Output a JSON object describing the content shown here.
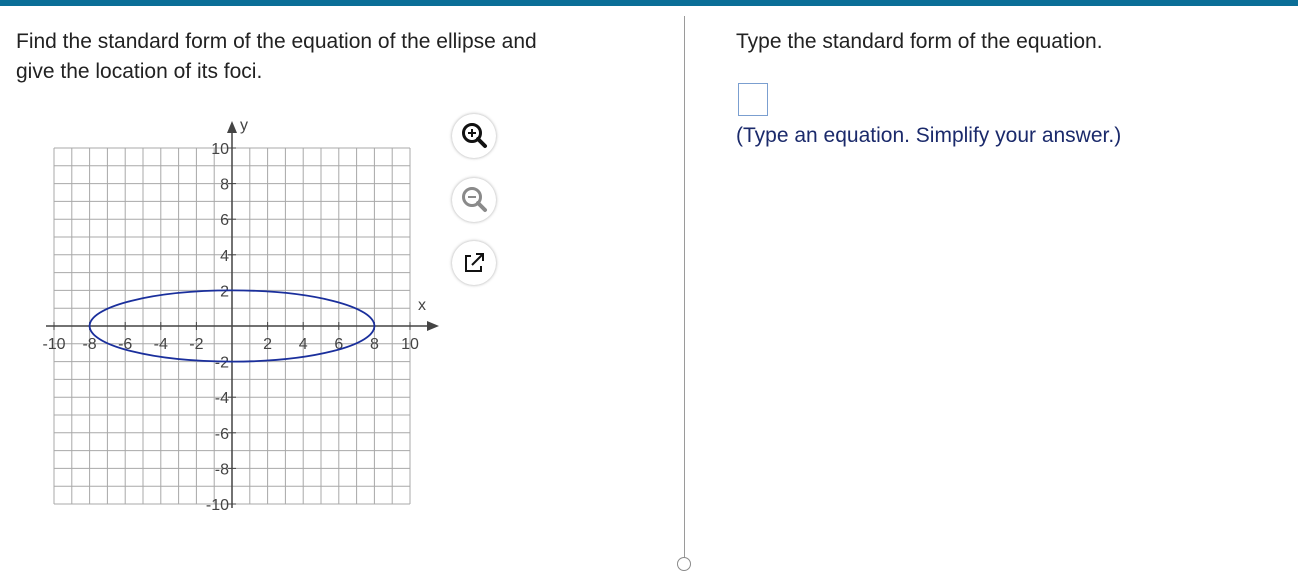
{
  "question": {
    "line1": "Find the standard form of the equation of the ellipse and",
    "line2": "give the location of its foci."
  },
  "answer_panel": {
    "instruction": "Type the standard form of the equation.",
    "answer_value": "",
    "hint": "(Type an equation. Simplify your answer.)"
  },
  "graph_tools": {
    "zoom_in_icon": "magnifier-plus-icon",
    "zoom_out_icon": "magnifier-minus-icon",
    "popout_icon": "external-link-icon"
  },
  "colors": {
    "top_bar": "#0b6e97",
    "ellipse": "#1a2f9c",
    "grid": "#a8a8a8",
    "axis": "#444444"
  },
  "chart_data": {
    "type": "scatter",
    "xlabel": "x",
    "ylabel": "y",
    "xlim": [
      -10,
      10
    ],
    "ylim": [
      -10,
      10
    ],
    "grid": true,
    "grid_step": 1,
    "x_ticks": [
      -10,
      -8,
      -6,
      -4,
      -2,
      2,
      4,
      6,
      8,
      10
    ],
    "y_ticks": [
      -10,
      -8,
      -6,
      -4,
      -2,
      2,
      4,
      6,
      8,
      10
    ],
    "x_tick_labels": [
      "-10",
      "-8",
      "-6",
      "-4",
      "-2",
      "2",
      "4",
      "6",
      "8",
      "10"
    ],
    "y_tick_labels": [
      "-10",
      "-8",
      "-6",
      "-4",
      "-2",
      "2",
      "4",
      "6",
      "8",
      "10"
    ],
    "ellipse": {
      "center": [
        0,
        0
      ],
      "semi_major_x": 8,
      "semi_minor_y": 2
    }
  }
}
